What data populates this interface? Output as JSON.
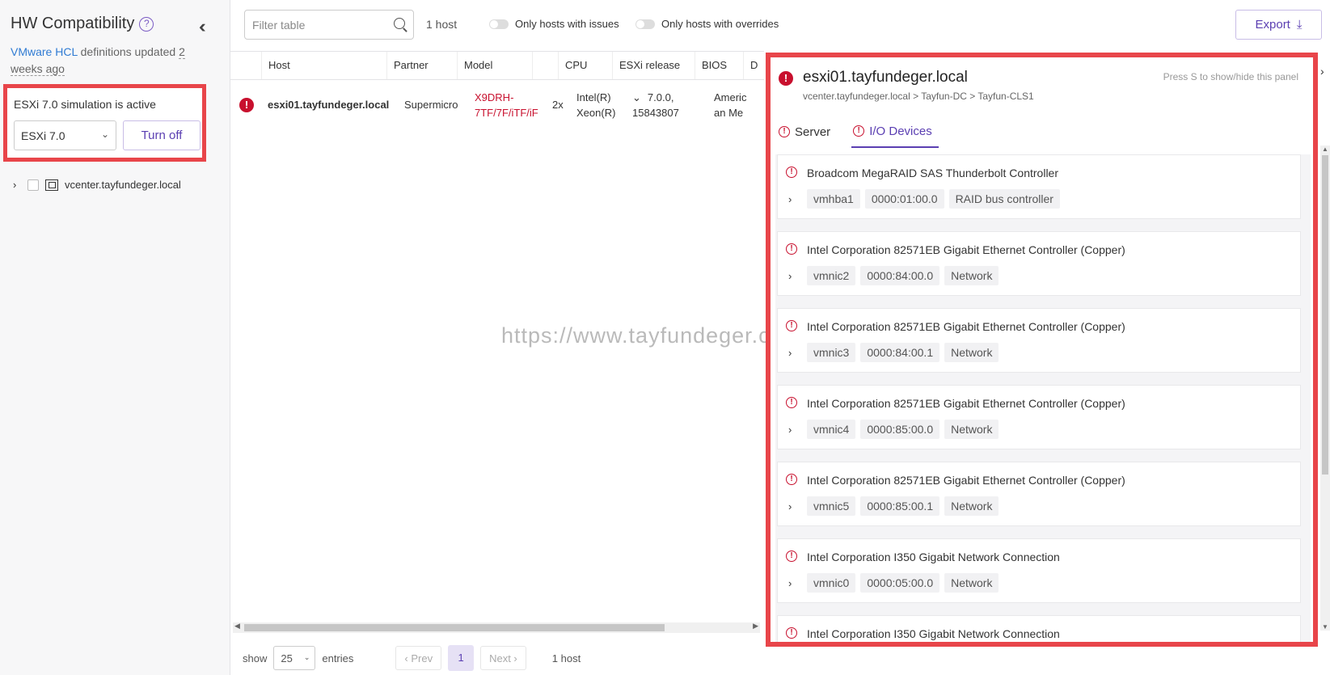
{
  "sidebar": {
    "title": "HW Compatibility",
    "help": "?",
    "hcl_link": "VMware HCL",
    "hcl_text": "definitions updated",
    "hcl_age_1": "2",
    "hcl_age_2": "weeks ago",
    "simulation_label": "ESXi 7.0 simulation is active",
    "simulation_version": "ESXi 7.0",
    "turn_off_label": "Turn off",
    "tree_item": "vcenter.tayfundeger.local"
  },
  "toolbar": {
    "filter_placeholder": "Filter table",
    "host_count": "1 host",
    "toggle_issues": "Only hosts with issues",
    "toggle_overrides": "Only hosts with overrides",
    "export_label": "Export"
  },
  "table": {
    "headers": [
      "Host",
      "Partner",
      "Model",
      "CPU",
      "ESXi release",
      "BIOS",
      "D"
    ],
    "row": {
      "host": "esxi01.tayfundeger.local",
      "partner": "Supermicro",
      "model_1": "X9DRH-",
      "model_2": "7TF/7F/iTF/iF",
      "cpu_count": "2x",
      "cpu_1": "Intel(R)",
      "cpu_2": "Xeon(R)",
      "esxi_1": "7.0.0,",
      "esxi_2": "15843807",
      "bios_1": "Americ",
      "bios_2": "an Me"
    }
  },
  "watermark": "https://www.tayfundeger.com",
  "pager": {
    "show": "show",
    "page_size": "25",
    "entries": "entries",
    "prev": "Prev",
    "page": "1",
    "next": "Next",
    "total": "1 host"
  },
  "detail": {
    "title": "esxi01.tayfundeger.local",
    "hint": "Press S to show/hide this panel",
    "breadcrumb": "vcenter.tayfundeger.local > Tayfun-DC > Tayfun-CLS1",
    "tab_server": "Server",
    "tab_io": "I/O Devices",
    "devices": [
      {
        "name": "Broadcom MegaRAID SAS Thunderbolt Controller",
        "tags": [
          "vmhba1",
          "0000:01:00.0",
          "RAID bus controller"
        ]
      },
      {
        "name": "Intel Corporation 82571EB Gigabit Ethernet Controller (Copper)",
        "tags": [
          "vmnic2",
          "0000:84:00.0",
          "Network"
        ]
      },
      {
        "name": "Intel Corporation 82571EB Gigabit Ethernet Controller (Copper)",
        "tags": [
          "vmnic3",
          "0000:84:00.1",
          "Network"
        ]
      },
      {
        "name": "Intel Corporation 82571EB Gigabit Ethernet Controller (Copper)",
        "tags": [
          "vmnic4",
          "0000:85:00.0",
          "Network"
        ]
      },
      {
        "name": "Intel Corporation 82571EB Gigabit Ethernet Controller (Copper)",
        "tags": [
          "vmnic5",
          "0000:85:00.1",
          "Network"
        ]
      },
      {
        "name": "Intel Corporation I350 Gigabit Network Connection",
        "tags": [
          "vmnic0",
          "0000:05:00.0",
          "Network"
        ]
      },
      {
        "name": "Intel Corporation I350 Gigabit Network Connection",
        "tags": []
      }
    ]
  },
  "colors": {
    "accent": "#5b3fb2",
    "error": "#c8102e",
    "highlight_border": "#e8454a",
    "link": "#2f7bd3"
  }
}
